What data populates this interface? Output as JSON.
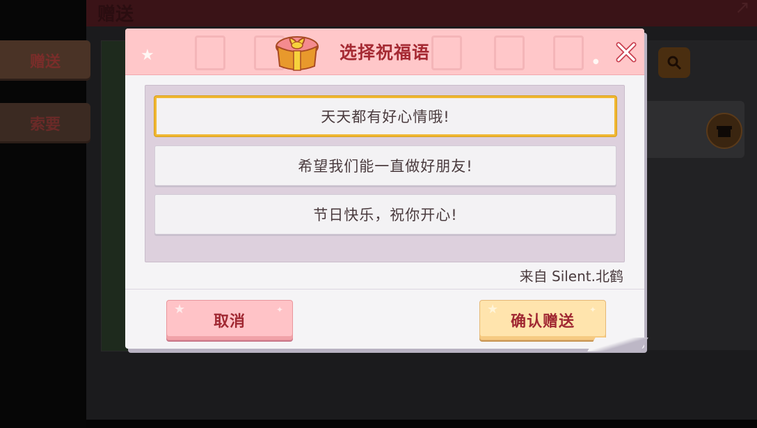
{
  "background": {
    "header_title": "赠送",
    "tabs": [
      {
        "label": "赠送",
        "active": true
      },
      {
        "label": "索要",
        "active": false
      }
    ]
  },
  "dialog": {
    "title": "选择祝福语",
    "wishes": [
      {
        "text": "天天都有好心情哦!",
        "selected": true
      },
      {
        "text": "希望我们能一直做好朋友!",
        "selected": false
      },
      {
        "text": "节日快乐，祝你开心!",
        "selected": false
      }
    ],
    "from_line": "来自 Silent.北鹤",
    "cancel_label": "取消",
    "confirm_label": "确认赠送"
  },
  "colors": {
    "header_bg": "#ffc7c9",
    "title_text": "#a52a33",
    "list_bg": "#ddd0dd",
    "selected_border": "#f0b731",
    "cancel_bg": "#ffc3c7",
    "confirm_bg": "#ffe4ad"
  },
  "icons": [
    "gift-icon",
    "close-icon",
    "search-icon",
    "gift-box-icon",
    "star-icon"
  ]
}
